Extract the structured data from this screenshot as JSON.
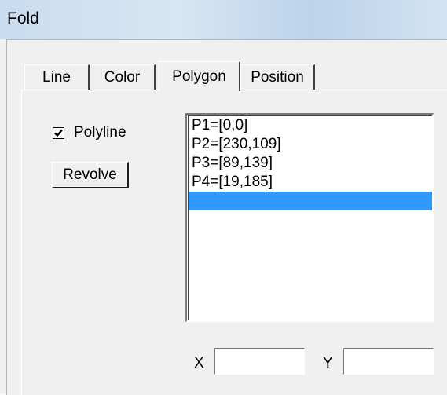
{
  "window": {
    "title": "Fold"
  },
  "tabs": [
    {
      "label": "Line"
    },
    {
      "label": "Color"
    },
    {
      "label": "Polygon",
      "active": true
    },
    {
      "label": "Position"
    }
  ],
  "polygon": {
    "polyline_label": "Polyline",
    "polyline_checked": true,
    "revolve_label": "Revolve",
    "points": [
      "P1=[0,0]",
      "P2=[230,109]",
      "P3=[89,139]",
      "P4=[19,185]",
      ""
    ],
    "selected_index": 4,
    "x_label": "X",
    "x_value": "",
    "y_label": "Y",
    "y_value": ""
  },
  "colors": {
    "selection": "#3399ff",
    "titlebar": "#c9dcef"
  }
}
